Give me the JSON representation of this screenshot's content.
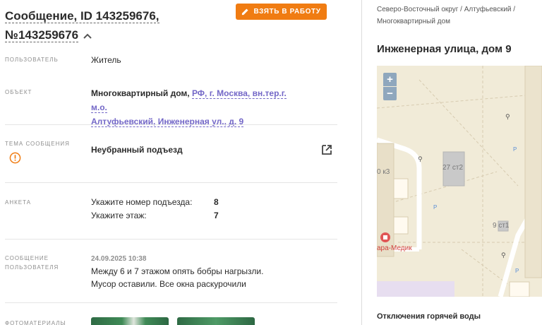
{
  "message": {
    "title_line1": "Сообщение, ID 143259676,",
    "title_line2": "№143259676",
    "take_button": "ВЗЯТЬ В РАБОТУ"
  },
  "fields": {
    "user_label": "ПОЛЬЗОВАТЕЛЬ",
    "user_value": "Житель",
    "object_label": "ОБЪЕКТ",
    "object_type": "Многоквартирный дом,",
    "object_address_line1": "РФ, г. Москва, вн.тер.г. м.о.",
    "object_address_line2": "Алтуфьевский, Инженерная ул., д. 9",
    "topic_label": "ТЕМА СООБЩЕНИЯ",
    "topic_value": "Неубранный подъезд",
    "form_label": "АНКЕТА",
    "q1_label": "Укажите номер подъезда:",
    "q1_value": "8",
    "q2_label": "Укажите этаж:",
    "q2_value": "7",
    "msg_label_line1": "СООБЩЕНИЕ",
    "msg_label_line2": "ПОЛЬЗОВАТЕЛЯ",
    "msg_date": "24.09.2025 10:38",
    "msg_line1": "Между 6 и 7 этажом опять бобры нагрызли.",
    "msg_line2": "Мусор оставили. Все окна раскурочили",
    "photos_label": "ФОТОМАТЕРИАЛЫ"
  },
  "side": {
    "breadcrumb_line1": "Северо-Восточный округ / Алтуфьевский /",
    "breadcrumb_line2": "Многоквартирный дом",
    "address": "Инженерная улица, дом 9",
    "zoom_in": "+",
    "zoom_out": "−",
    "map_labels": {
      "b1": "27 ст2",
      "b2": "0 к3",
      "b3": "9 ст1",
      "clinic": "ара-Медик",
      "parking": "P"
    },
    "outages_title": "Отключения горячей воды"
  },
  "colors": {
    "accent": "#f07c12",
    "link": "#7367c7",
    "warning": "#f07c12",
    "map_bg": "#f1ebd8",
    "zoom_bg": "#8fa7bd"
  },
  "icons": {
    "pencil": "pencil-icon",
    "chevron": "chevron-up-icon",
    "warning": "warning-circle-icon",
    "external": "external-link-icon"
  }
}
